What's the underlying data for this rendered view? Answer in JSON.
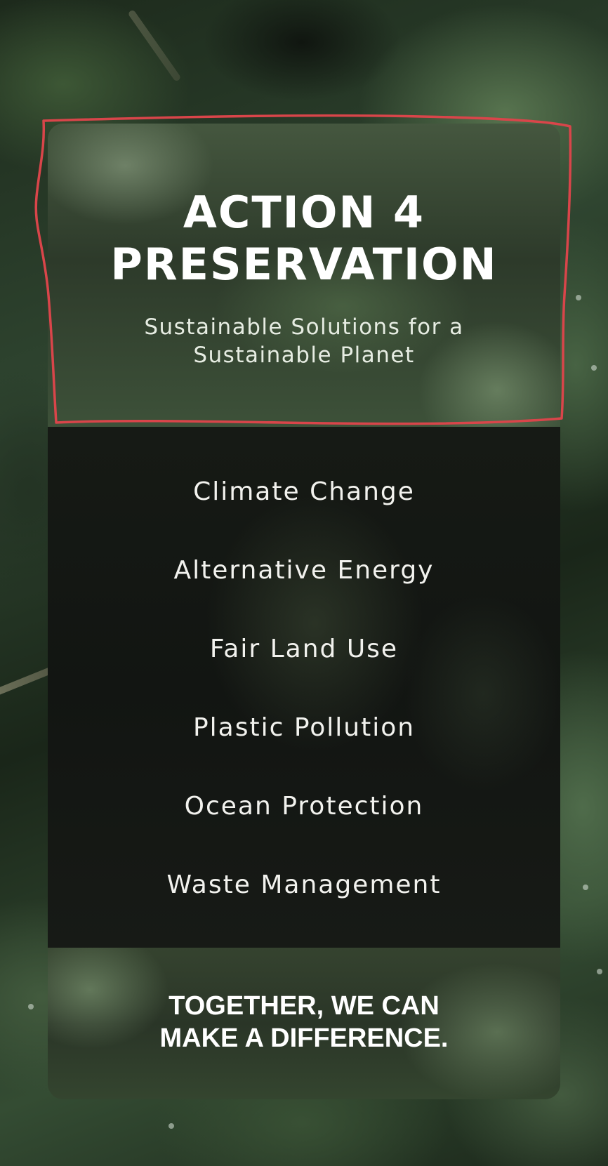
{
  "colors": {
    "annotation": "#d9454a",
    "text_primary": "#ffffff",
    "card_dark": "#141813",
    "card_green": "#3a4b36"
  },
  "hero": {
    "title_line1": "ACTION 4",
    "title_line2": "PRESERVATION",
    "subtitle_line1": "Sustainable Solutions for a",
    "subtitle_line2": "Sustainable Planet"
  },
  "topics": [
    {
      "label": "Climate Change"
    },
    {
      "label": "Alternative Energy"
    },
    {
      "label": "Fair Land Use"
    },
    {
      "label": "Plastic Pollution"
    },
    {
      "label": "Ocean Protection"
    },
    {
      "label": "Waste Management"
    }
  ],
  "footer": {
    "cta_line1": "TOGETHER, WE CAN",
    "cta_line2": "MAKE A DIFFERENCE."
  }
}
